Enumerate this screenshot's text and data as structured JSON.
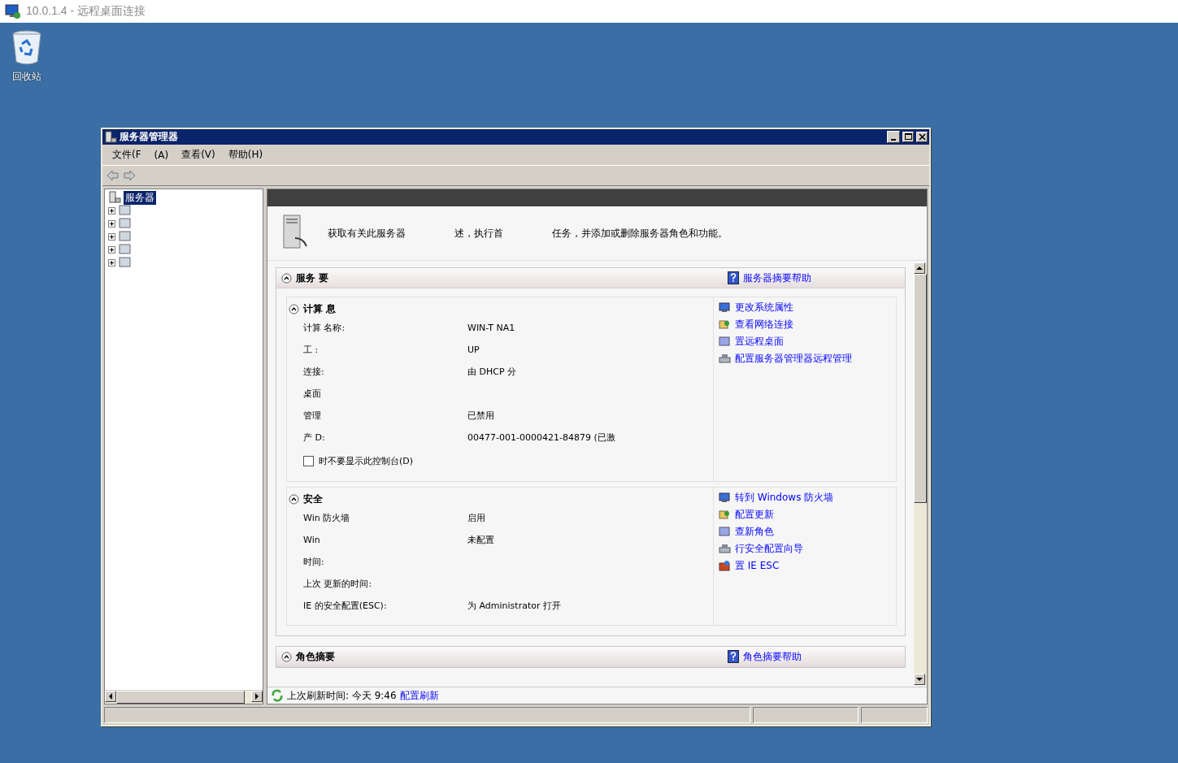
{
  "rdp": {
    "title": "10.0.1.4 - 远程桌面连接"
  },
  "desktop_icons": [
    {
      "label": "回收站"
    }
  ],
  "window": {
    "title": "服务器管理器"
  },
  "menu": [
    "文件(F",
    "(A)",
    "查看(V)",
    "帮助(H)"
  ],
  "tree": {
    "label": "服务器",
    "selected": true,
    "children": [
      {
        "expanded": false
      },
      {
        "expanded": false
      },
      {
        "expanded": false
      },
      {
        "expanded": false
      },
      {
        "expanded": false
      }
    ]
  },
  "description": [
    "获取有关此服务器",
    "述，执行首",
    "任务，并添加或删除服务器角色和功能。"
  ],
  "sections": [
    {
      "title": "服务 要",
      "help_link": "服务器摘要帮助",
      "expanded": true,
      "groups": [
        {
          "title": "计算 息",
          "expanded": true,
          "rows": [
            {
              "label": "计算 名称:",
              "value": "WIN-T NA1"
            },
            {
              "label": "工 :",
              "value": "UP"
            },
            {
              "label": "连接:",
              "value": "由 DHCP 分"
            },
            {
              "label": "桌面"
            },
            {
              "label": "管理",
              "value": "已禁用"
            },
            {
              "label": "产 D:",
              "value": "00477-001-0000421-84879 (已激"
            }
          ],
          "checkbox": {
            "label": "时不要显示此控制台(D)",
            "checked": false
          },
          "links": [
            "更改系统属性",
            "查看网络连接",
            "置远程桌面",
            "配置服务器管理器远程管理"
          ]
        },
        {
          "title": "安全",
          "expanded": true,
          "rows": [
            {
              "label": "Win 防火墙",
              "value": "启用"
            },
            {
              "label": "Win",
              "value": "未配置"
            },
            {
              "label": "时间:"
            },
            {
              "label": "上次 更新的时间:"
            },
            {
              "label": "IE 的安全配置(ESC):",
              "value": "为 Administrator 打开"
            }
          ],
          "links": [
            "转到 Windows 防火墙",
            "配置更新",
            "查新角色",
            "行安全配置向导",
            "置 IE ESC"
          ]
        }
      ]
    },
    {
      "title": "角色摘要",
      "help_link": "角色摘要帮助",
      "expanded": true
    }
  ],
  "footer": {
    "refresh_text": "上次刷新时间: 今天 9:46",
    "link": "配置刷新"
  }
}
